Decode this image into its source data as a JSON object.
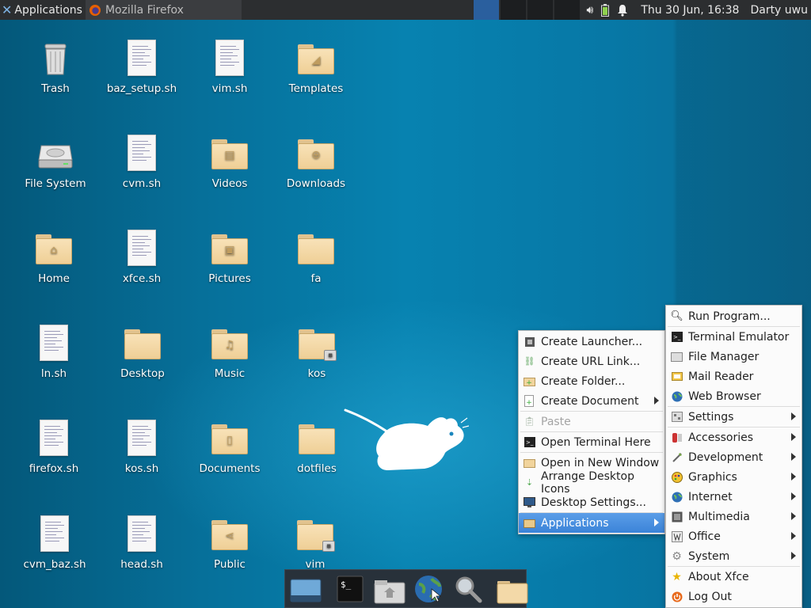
{
  "panel": {
    "applications_label": "Applications",
    "task_label": "Mozilla Firefox",
    "clock": "Thu 30 Jun, 16:38",
    "user": "Darty uwu"
  },
  "desktop": {
    "icons": [
      {
        "label": "Trash"
      },
      {
        "label": "baz_setup.sh"
      },
      {
        "label": "vim.sh"
      },
      {
        "label": "Templates"
      },
      {
        "label": "File System"
      },
      {
        "label": "cvm.sh"
      },
      {
        "label": "Videos"
      },
      {
        "label": "Downloads"
      },
      {
        "label": "Home"
      },
      {
        "label": "xfce.sh"
      },
      {
        "label": "Pictures"
      },
      {
        "label": "fa"
      },
      {
        "label": "ln.sh"
      },
      {
        "label": "Desktop"
      },
      {
        "label": "Music"
      },
      {
        "label": "kos"
      },
      {
        "label": "firefox.sh"
      },
      {
        "label": "kos.sh"
      },
      {
        "label": "Documents"
      },
      {
        "label": "dotfiles"
      },
      {
        "label": "cvm_baz.sh"
      },
      {
        "label": "head.sh"
      },
      {
        "label": "Public"
      },
      {
        "label": "vim"
      }
    ]
  },
  "context_menu": {
    "items": [
      {
        "label": "Create Launcher..."
      },
      {
        "label": "Create URL Link..."
      },
      {
        "label": "Create Folder..."
      },
      {
        "label": "Create Document"
      },
      {
        "label": "Paste"
      },
      {
        "label": "Open Terminal Here"
      },
      {
        "label": "Open in New Window"
      },
      {
        "label": "Arrange Desktop Icons"
      },
      {
        "label": "Desktop Settings..."
      },
      {
        "label": "Applications"
      }
    ]
  },
  "apps_menu": {
    "items": [
      {
        "label": "Run Program..."
      },
      {
        "label": "Terminal Emulator"
      },
      {
        "label": "File Manager"
      },
      {
        "label": "Mail Reader"
      },
      {
        "label": "Web Browser"
      },
      {
        "label": "Settings"
      },
      {
        "label": "Accessories"
      },
      {
        "label": "Development"
      },
      {
        "label": "Graphics"
      },
      {
        "label": "Internet"
      },
      {
        "label": "Multimedia"
      },
      {
        "label": "Office"
      },
      {
        "label": "System"
      },
      {
        "label": "About Xfce"
      },
      {
        "label": "Log Out"
      }
    ]
  },
  "colors": {
    "panel": "#2c2e30",
    "menu_selection": "#3b83d8",
    "desktop": "#0782b0"
  }
}
